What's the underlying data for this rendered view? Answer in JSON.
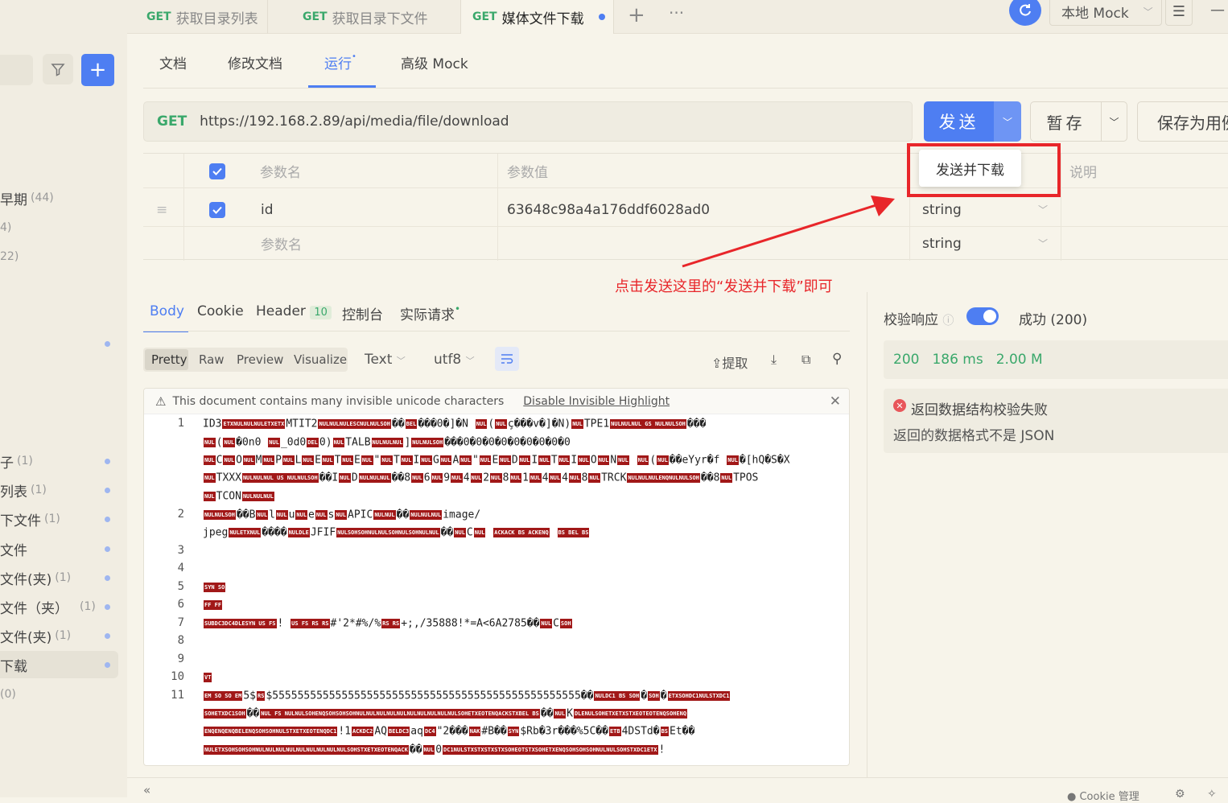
{
  "sidebar": {
    "items": [
      {
        "label": "早期",
        "count": "(44)"
      },
      {
        "label": "4)",
        "count": ""
      },
      {
        "label": "22)",
        "count": ""
      },
      {
        "label": "",
        "count": ""
      },
      {
        "label": "子",
        "count": "(1)"
      },
      {
        "label": "列表",
        "count": "(1)"
      },
      {
        "label": "下文件",
        "count": "(1)"
      },
      {
        "label": "文件",
        "count": ""
      },
      {
        "label": "文件(夹)",
        "count": "(1)"
      },
      {
        "label": "文件（夹）",
        "count": "(1)"
      },
      {
        "label": "文件(夹)",
        "count": "(1)"
      },
      {
        "label": "下载",
        "count": ""
      },
      {
        "label": "(0)",
        "count": ""
      }
    ]
  },
  "tabs": [
    {
      "method": "GET",
      "label": "获取目录列表"
    },
    {
      "method": "GET",
      "label": "获取目录下文件"
    },
    {
      "method": "GET",
      "label": "媒体文件下载"
    }
  ],
  "header": {
    "env": "本地 Mock"
  },
  "subtabs": [
    "文档",
    "修改文档",
    "运行",
    "高级 Mock"
  ],
  "request": {
    "method": "GET",
    "url": "https://192.168.2.89/api/media/file/download",
    "send": "发送",
    "save": "暂存",
    "save_as": "保存为用例"
  },
  "dropdown": {
    "item": "发送并下载"
  },
  "params": {
    "headers": {
      "name": "参数名",
      "value": "参数值",
      "desc": "说明"
    },
    "rows": [
      {
        "name": "id",
        "value": "63648c98a4a176ddf6028ad0",
        "type": "string"
      },
      {
        "name": "参数名",
        "value": "",
        "type": "string"
      }
    ]
  },
  "annotation": "点击发送这里的“发送并下载”即可",
  "response": {
    "tabs": [
      "Body",
      "Cookie",
      "Header",
      "控制台",
      "实际请求"
    ],
    "header_count": "10",
    "view_modes": [
      "Pretty",
      "Raw",
      "Preview",
      "Visualize"
    ],
    "format": "Text",
    "encoding": "utf8",
    "extract": "提取",
    "warning": "This document contains many invisible unicode characters",
    "warning_link": "Disable Invisible Highlight",
    "line_numbers": [
      "1",
      "2",
      "3",
      "4",
      "5",
      "6",
      "7",
      "8",
      "9",
      "10",
      "11"
    ]
  },
  "validation": {
    "label": "校验响应",
    "status": "成功 (200)",
    "code": "200",
    "time": "186 ms",
    "size": "2.00 M",
    "error_title": "返回数据结构校验失败",
    "error_msg": "返回的数据格式不是 JSON"
  },
  "footer": {
    "cookie": "Cookie 管理"
  }
}
